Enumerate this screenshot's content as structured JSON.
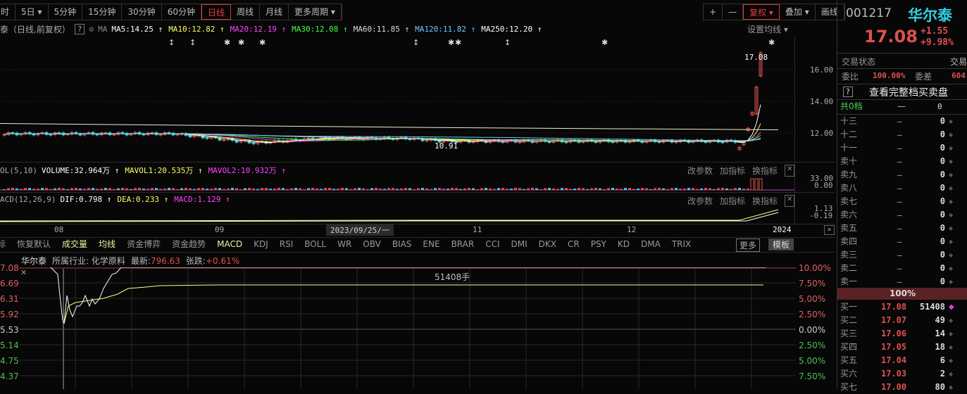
{
  "toolbar": {
    "periods": [
      "时",
      "5日 ▾",
      "5分钟",
      "15分钟",
      "30分钟",
      "60分钟",
      "日线",
      "周线",
      "月线",
      "更多周期 ▾"
    ],
    "active": "日线",
    "right": [
      "+",
      "—",
      "复权 ▾",
      "叠加 ▾",
      "画线"
    ]
  },
  "ma_legend": {
    "title": "泰（日线,前复权）",
    "help": "?",
    "ma": "MA",
    "items": [
      {
        "text": "MA5:14.25 ↑",
        "color": "#ffffff"
      },
      {
        "text": "MA10:12.82 ↑",
        "color": "#ffff66"
      },
      {
        "text": "MA20:12.19 ↑",
        "color": "#ff44ff"
      },
      {
        "text": "MA30:12.08 ↑",
        "color": "#44ff44"
      },
      {
        "text": "MA60:11.85 ↑",
        "color": "#dddddd"
      },
      {
        "text": "MA120:11.82 ↑",
        "color": "#66ccff"
      },
      {
        "text": "MA250:12.20 ↑",
        "color": "#ffffff"
      }
    ],
    "set_ma": "设置均线 ▾"
  },
  "price_axis": [
    "16.00",
    "14.00",
    "12.00"
  ],
  "annotations": {
    "high": "17.08",
    "low": "10.91"
  },
  "vol": {
    "title": "OL(5,10)",
    "items": [
      {
        "text": "VOLUME:32.964万 ↑",
        "color": "#ffffff"
      },
      {
        "text": "MAVOL1:20.535万 ↑",
        "color": "#ffff66"
      },
      {
        "text": "MAVOL2:10.932万 ↑",
        "color": "#ff44ff"
      }
    ],
    "axis": [
      "33.00",
      "0.00"
    ]
  },
  "macd": {
    "title": "ACD(12,26,9)",
    "items": [
      {
        "text": "DIF:0.798 ↑",
        "color": "#ffffff"
      },
      {
        "text": "DEA:0.233 ↑",
        "color": "#ffff66"
      },
      {
        "text": "MACD:1.129 ↑",
        "color": "#ff44ff"
      }
    ],
    "axis": [
      "1.13",
      "-0.19"
    ]
  },
  "panel_actions": [
    "改参数",
    "加指标",
    "换指标"
  ],
  "date_axis": {
    "labels": [
      "08",
      "09",
      "11",
      "12",
      "2024"
    ],
    "cursor": "2023/09/25/一"
  },
  "indicator_tabs": [
    "标",
    "恢复默认",
    "成交量",
    "均线",
    "资金博弈",
    "资金趋势",
    "MACD",
    "KDJ",
    "RSI",
    "BOLL",
    "WR",
    "OBV",
    "BIAS",
    "ENE",
    "BRAR",
    "CCI",
    "DMI",
    "DKX",
    "CR",
    "PSY",
    "KD",
    "DMA",
    "TRIX"
  ],
  "more": "更多",
  "template": "模板",
  "intraday": {
    "name": "华尔泰",
    "industry": "所属行业: 化学原料",
    "latest_label": "最新:",
    "latest": "796.63",
    "change_label": "张跌:",
    "change": "+0.61%",
    "volume_note": "51408手",
    "left_axis": [
      "7.08",
      "6.69",
      "6.31",
      "5.92",
      "5.53",
      "5.14",
      "4.75",
      "4.37"
    ],
    "right_axis": [
      "10.00%",
      "7.50%",
      "5.00%",
      "2.50%",
      "0.00%",
      "2.50%",
      "5.00%",
      "7.50%"
    ]
  },
  "quote": {
    "code": "001217",
    "name": "华尔泰",
    "price": "17.08",
    "change": "+1.55",
    "change_pct": "+9.98%",
    "status_label": "交易状态",
    "status_value": "交易",
    "ratio_label": "委比",
    "ratio": "100.00%",
    "diff_label": "委差",
    "diff": "604",
    "full_book": "查看完整档买卖盘",
    "total_label": "共0档",
    "total_price": "—",
    "total_vol": "0",
    "asks": [
      [
        "十三",
        "—",
        "0"
      ],
      [
        "十二",
        "—",
        "0"
      ],
      [
        "十一",
        "—",
        "0"
      ],
      [
        "卖十",
        "—",
        "0"
      ],
      [
        "卖九",
        "—",
        "0"
      ],
      [
        "卖八",
        "—",
        "0"
      ],
      [
        "卖七",
        "—",
        "0"
      ],
      [
        "卖六",
        "—",
        "0"
      ],
      [
        "卖五",
        "—",
        "0"
      ],
      [
        "卖四",
        "—",
        "0"
      ],
      [
        "卖三",
        "—",
        "0"
      ],
      [
        "卖二",
        "—",
        "0"
      ],
      [
        "卖一",
        "—",
        "0"
      ]
    ],
    "mid": "100%",
    "bids": [
      [
        "买一",
        "17.08",
        "51408"
      ],
      [
        "买二",
        "17.07",
        "49"
      ],
      [
        "买三",
        "17.06",
        "14"
      ],
      [
        "买四",
        "17.05",
        "18"
      ],
      [
        "买五",
        "17.04",
        "6"
      ],
      [
        "买六",
        "17.03",
        "2"
      ],
      [
        "买七",
        "17.00",
        "80"
      ]
    ]
  },
  "colors": {
    "up": "#e05050",
    "down": "#40d0d0",
    "accent": "#d03a30"
  }
}
